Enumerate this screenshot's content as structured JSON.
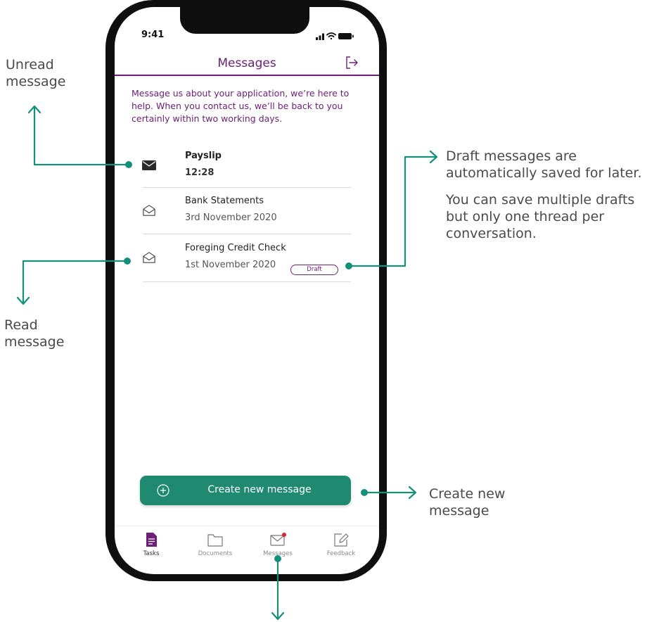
{
  "annotations": {
    "unread": "Unread message",
    "unread_line1": "Unread",
    "unread_line2": "message",
    "read_line1": "Read",
    "read_line2": "message",
    "draft_line1": "Draft messages are",
    "draft_line2": "automatically saved for later.",
    "draft_line3": "You can save multiple drafts",
    "draft_line4": "but only one thread per",
    "draft_line5": "conversation.",
    "create_line1": "Create new",
    "create_line2": "message"
  },
  "status_bar": {
    "time": "9:41"
  },
  "header": {
    "title": "Messages"
  },
  "intro": "Message us about your application, we’re here to help. When you contact us, we’ll be back to you certainly within two working days.",
  "messages": [
    {
      "title": "Payslip",
      "subtitle": "12:28",
      "status": "unread",
      "icon": "envelope-closed-icon"
    },
    {
      "title": "Bank Statements",
      "subtitle": "3rd November 2020",
      "status": "read",
      "icon": "envelope-open-icon"
    },
    {
      "title": "Foreging Credit Check",
      "subtitle": "1st November 2020",
      "status": "read",
      "badge": "Draft",
      "icon": "envelope-open-icon"
    }
  ],
  "create_button": {
    "label": "Create new message"
  },
  "tabs": [
    {
      "label": "Tasks",
      "icon": "tasks-icon",
      "active": true
    },
    {
      "label": "Documents",
      "icon": "folder-icon"
    },
    {
      "label": "Messages",
      "icon": "envelope-icon",
      "notification_dot": true
    },
    {
      "label": "Feedback",
      "icon": "edit-icon"
    }
  ],
  "colors": {
    "brand_purple": "#6d2077",
    "brand_green": "#1f8a70",
    "annotation_teal": "#14907a",
    "notification_red": "#e0232a"
  }
}
